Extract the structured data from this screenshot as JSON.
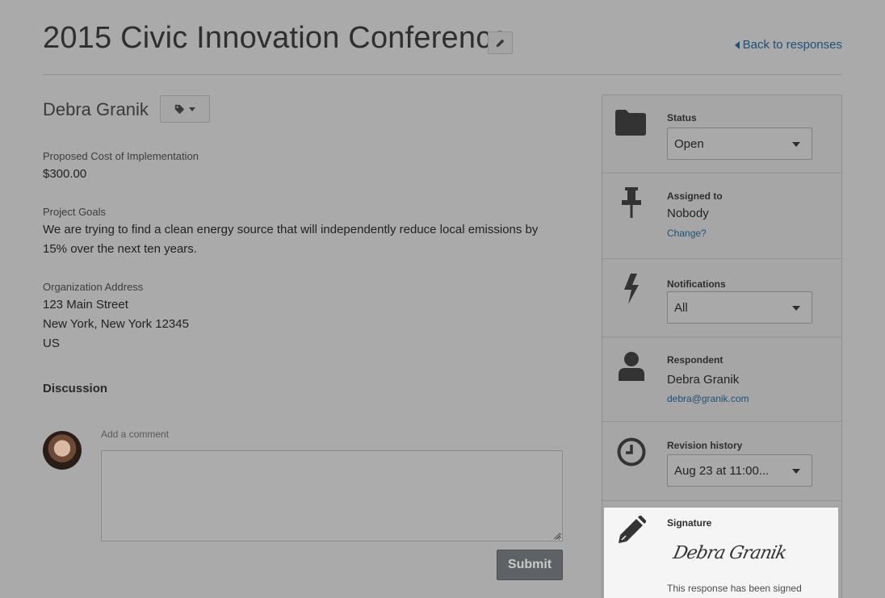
{
  "header": {
    "title": "2015 Civic Innovation Conference",
    "back_link": "Back to responses"
  },
  "response": {
    "name": "Debra Granik",
    "fields": [
      {
        "label": "Proposed Cost of Implementation",
        "value": "$300.00"
      },
      {
        "label": "Project Goals",
        "value": "We are trying to find a clean energy source that will independently reduce local emissions by 15% over the next ten years."
      },
      {
        "label": "Organization Address",
        "lines": [
          "123 Main Street",
          "New York, New York 12345",
          "US"
        ]
      }
    ]
  },
  "discussion": {
    "title": "Discussion",
    "comment_label": "Add a comment",
    "comment_value": "",
    "submit_label": "Submit"
  },
  "sidebar": {
    "status": {
      "label": "Status",
      "value": "Open",
      "icon": "folder-icon"
    },
    "assigned": {
      "label": "Assigned to",
      "value": "Nobody",
      "link": "Change?",
      "icon": "pin-icon"
    },
    "notifications": {
      "label": "Notifications",
      "value": "All",
      "icon": "lightning-icon"
    },
    "respondent": {
      "label": "Respondent",
      "name": "Debra Granik",
      "email": "debra@granik.com",
      "icon": "user-icon"
    },
    "revision": {
      "label": "Revision history",
      "value": "Aug 23 at 11:00...",
      "icon": "clock-icon"
    },
    "signature": {
      "label": "Signature",
      "signature_text": "Debra Granik",
      "note": "This response has been signed",
      "icon": "pencil-icon"
    }
  },
  "colors": {
    "background": "#aaaaaa",
    "link": "#1f4f7a",
    "submit_bg": "#5e6166",
    "signature_bg": "#f5f5f5"
  }
}
